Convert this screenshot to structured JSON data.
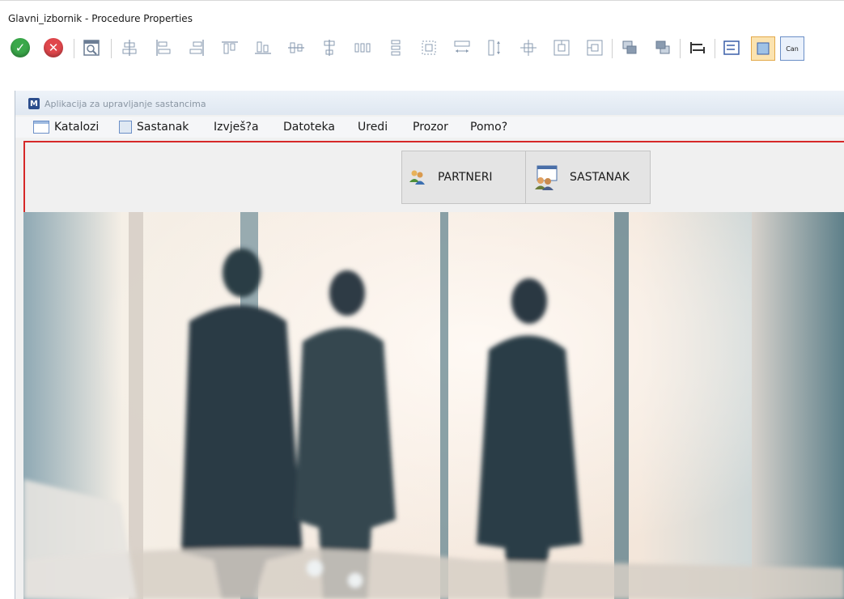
{
  "window": {
    "title": "Glavni_izbornik - Procedure Properties"
  },
  "toolbar": {
    "icons": [
      "ok-icon",
      "cancel-icon",
      "preview-icon",
      "align-center-icon",
      "align-left-icon",
      "align-right-icon",
      "align-top-icon",
      "align-bottom-icon",
      "center-horizontal-icon",
      "center-vertical-icon",
      "distribute-horizontal-icon",
      "distribute-vertical-icon",
      "same-size-icon",
      "same-width-icon",
      "same-height-icon",
      "center-in-window-icon",
      "center-vertical-window-icon",
      "center-horizontal-window-icon",
      "bring-front-icon",
      "send-back-icon",
      "tab-order-icon",
      "next-control-icon",
      "select-icon",
      "cancel-label-icon"
    ],
    "last_icon_label": "Can"
  },
  "app": {
    "title": "Aplikacija za upravljanje sastancima",
    "logo_letter": "M",
    "menu": [
      {
        "label": "Katalozi",
        "icon": "catalog-icon"
      },
      {
        "label": "Sastanak",
        "icon": "meeting-icon"
      },
      {
        "label": "Izvješ?a",
        "icon": ""
      },
      {
        "label": "Datoteka",
        "icon": ""
      },
      {
        "label": "Uredi",
        "icon": ""
      },
      {
        "label": "Prozor",
        "icon": ""
      },
      {
        "label": "Pomo?",
        "icon": ""
      }
    ],
    "buttons": [
      {
        "label": "PARTNERI",
        "icon": "partners-icon"
      },
      {
        "label": "SASTANAK",
        "icon": "meeting-calendar-icon"
      }
    ]
  },
  "colors": {
    "ok": "#3aa84a",
    "cancel": "#e0474c",
    "highlight_border": "#d62828",
    "toolbar_glyph": "#8a9bb0"
  }
}
